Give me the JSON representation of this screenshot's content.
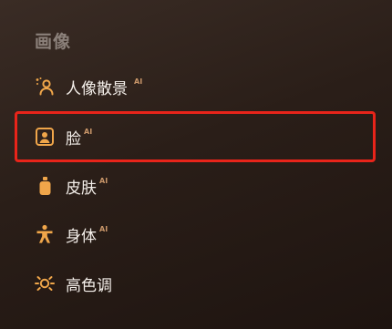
{
  "section": {
    "title": "画像"
  },
  "items": [
    {
      "label": "人像散景",
      "badge": "AI",
      "icon": "portrait-bokeh-icon",
      "selected": false
    },
    {
      "label": "脸",
      "badge": "AI",
      "icon": "face-icon",
      "selected": true
    },
    {
      "label": "皮肤",
      "badge": "AI",
      "icon": "skin-bottle-icon",
      "selected": false
    },
    {
      "label": "身体",
      "badge": "AI",
      "icon": "body-icon",
      "selected": false
    },
    {
      "label": "高色调",
      "badge": "",
      "icon": "high-tone-sun-icon",
      "selected": false
    }
  ],
  "colors": {
    "accent_icon": "#f0a64a",
    "ai_badge": "#c99669",
    "selection": "#e8241a"
  }
}
